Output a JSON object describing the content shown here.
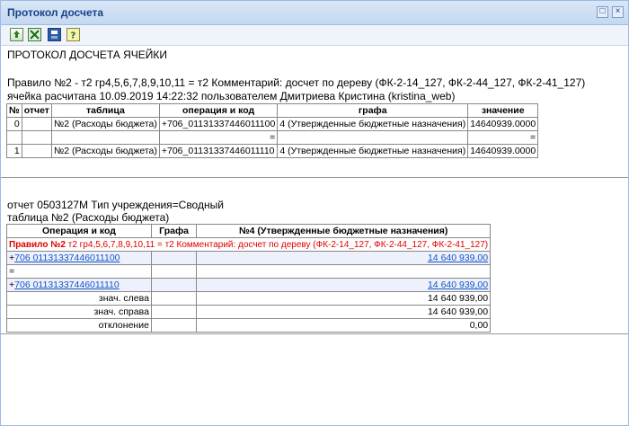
{
  "window": {
    "title": "Протокол досчета"
  },
  "toolbar": {
    "buttons": [
      {
        "name": "export-icon"
      },
      {
        "name": "excel-icon"
      },
      {
        "name": "save-icon"
      },
      {
        "name": "help-icon"
      }
    ]
  },
  "protocol": {
    "heading": "ПРОТОКОЛ ДОСЧЕТА ЯЧЕЙКИ",
    "rule": "Правило №2 - т2 гр4,5,6,7,8,9,10,11 = т2 Комментарий: досчет по дереву (ФК-2-14_127, ФК-2-44_127, ФК-2-41_127)",
    "calc": "ячейка расчитана 10.09.2019 14:22:32 пользователем Дмитриева Кристина (kristina_web)",
    "headers": [
      "№",
      "отчет",
      "таблица",
      "операция и код",
      "графа",
      "значение"
    ],
    "rows": [
      [
        "0",
        "",
        "№2 (Расходы бюджета)",
        "+706_01131337446011100",
        "4 (Утвержденные бюджетные назначения)",
        "14640939.0000"
      ],
      [
        "",
        "",
        "",
        "=",
        "",
        "="
      ],
      [
        "1",
        "",
        "№2 (Расходы бюджета)",
        "+706_01131337446011110",
        "4 (Утвержденные бюджетные назначения)",
        "14640939.0000"
      ]
    ]
  },
  "report": {
    "line1": "отчет 0503127М Тип учреждения=Сводный",
    "line2": "таблица №2 (Расходы бюджета)",
    "headers": [
      "Операция и код",
      "Графа",
      "№4 (Утвержденные бюджетные назначения)"
    ],
    "rule_prefix": "Правило №2",
    "rule_text": " т2 гр4,5,6,7,8,9,10,11 = т2 Комментарий: досчет по дереву (ФК-2-14_127, ФК-2-44_127, ФК-2-41_127)",
    "row1_sign": "+",
    "row1_code": "706 01131337446011100",
    "row1_value": "14 640 939,00",
    "row2_sign": "=",
    "row3_sign": "+",
    "row3_code": "706 01131337446011110",
    "row3_value": "14 640 939,00",
    "summary": [
      {
        "label": "знач. слева",
        "value": "14 640 939,00"
      },
      {
        "label": "знач. справа",
        "value": "14 640 939,00"
      },
      {
        "label": "отклонение",
        "value": "0,00"
      }
    ]
  }
}
